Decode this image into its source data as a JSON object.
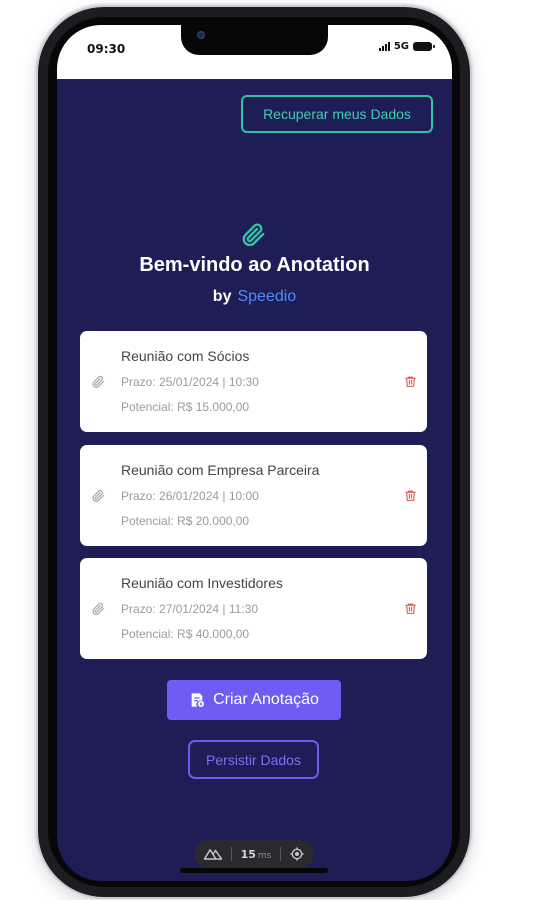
{
  "status_bar": {
    "time": "09:30",
    "network": "5G"
  },
  "header": {
    "recover_button_label": "Recuperar meus Dados"
  },
  "hero": {
    "welcome": "Bem-vindo ao Anotation",
    "by": "by",
    "brand": "Speedio"
  },
  "notes": [
    {
      "title": "Reunião com Sócios",
      "prazo": "Prazo: 25/01/2024 | 10:30",
      "potencial": "Potencial: R$ 15.000,00"
    },
    {
      "title": "Reunião com Empresa Parceira",
      "prazo": "Prazo: 26/01/2024 | 10:00",
      "potencial": "Potencial: R$ 20.000,00"
    },
    {
      "title": "Reunião com Investidores",
      "prazo": "Prazo: 27/01/2024 | 11:30",
      "potencial": "Potencial: R$ 40.000,00"
    }
  ],
  "actions": {
    "create_label": "Criar Anotação",
    "persist_label": "Persistir Dados"
  },
  "dev_toolbar": {
    "value": "15",
    "unit": "ms"
  },
  "colors": {
    "background": "#1f1d55",
    "accent_teal": "#33c3a2",
    "brand_blue": "#4d8dff",
    "primary_purple": "#6f5cf5",
    "delete_red": "#e0524f"
  },
  "icons": {
    "logo": "paperclip-icon",
    "note": "paperclip-icon",
    "delete": "trash-icon",
    "create": "note-add-icon",
    "devtools_logo": "nuxt-logo-icon",
    "devtools_target": "crosshair-icon"
  }
}
